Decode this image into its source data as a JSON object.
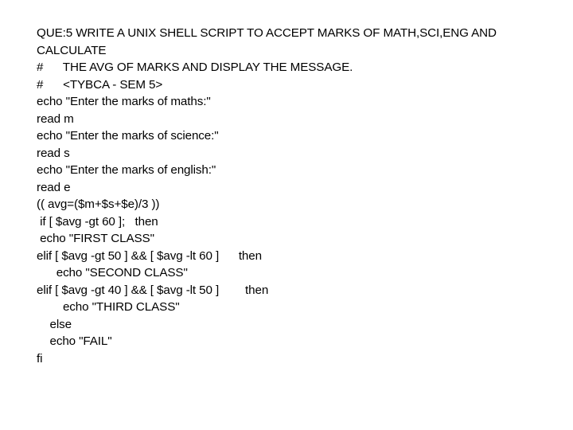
{
  "document": {
    "background_color": "#ffffff",
    "text_color": "#000000",
    "title": "QUE:5 WRITE A UNIX SHELL SCRIPT TO ACCEPT MARKS OF MATH,SCI,ENG AND CALCULATE",
    "lines": [
      {
        "text": "QUE:5 WRITE A UNIX SHELL SCRIPT TO ACCEPT MARKS OF MATH,SCI,ENG AND",
        "indent": 0
      },
      {
        "text": "CALCULATE",
        "indent": 0
      },
      {
        "text": "#      THE AVG OF MARKS AND DISPLAY THE MESSAGE.",
        "indent": 0
      },
      {
        "text": "#      <TYBCA - SEM 5>",
        "indent": 0
      },
      {
        "text": "echo \"Enter the marks of maths:\"",
        "indent": 0
      },
      {
        "text": "read m",
        "indent": 0
      },
      {
        "text": "echo \"Enter the marks of science:\"",
        "indent": 0
      },
      {
        "text": "read s",
        "indent": 0
      },
      {
        "text": "echo \"Enter the marks of english:\"",
        "indent": 0
      },
      {
        "text": "read e",
        "indent": 0
      },
      {
        "text": "(( avg=($m+$s+$e)/3 ))",
        "indent": 0
      },
      {
        "text": " if [ $avg -gt 60 ];   then",
        "indent": 0
      },
      {
        "text": " echo \"FIRST CLASS\"",
        "indent": 0
      },
      {
        "text": "elif [ $avg -gt 50 ] && [ $avg -lt 60 ]      then",
        "indent": 0
      },
      {
        "text": "      echo \"SECOND CLASS\"",
        "indent": 0
      },
      {
        "text": "elif [ $avg -gt 40 ] && [ $avg -lt 50 ]        then",
        "indent": 0
      },
      {
        "text": "        echo \"THIRD CLASS\"",
        "indent": 0
      },
      {
        "text": "    else",
        "indent": 0
      },
      {
        "text": "    echo \"FAIL\"",
        "indent": 0
      },
      {
        "text": "fi",
        "indent": 0
      }
    ]
  },
  "script": {
    "language": "unix-shell",
    "question_number": "QUE:5",
    "course_tag": "<TYBCA - SEM 5>",
    "variables": [
      "m",
      "s",
      "e",
      "avg"
    ],
    "prompts": [
      "Enter the marks of maths:",
      "Enter the marks of science:",
      "Enter the marks of english:"
    ],
    "grade_outputs": [
      "FIRST CLASS",
      "SECOND CLASS",
      "THIRD CLASS",
      "FAIL"
    ],
    "thresholds": {
      "first_class_gt": "60",
      "second_class_gt": "50",
      "second_class_lt": "60",
      "third_class_gt": "40",
      "third_class_lt": "50",
      "divisor": "3"
    }
  }
}
